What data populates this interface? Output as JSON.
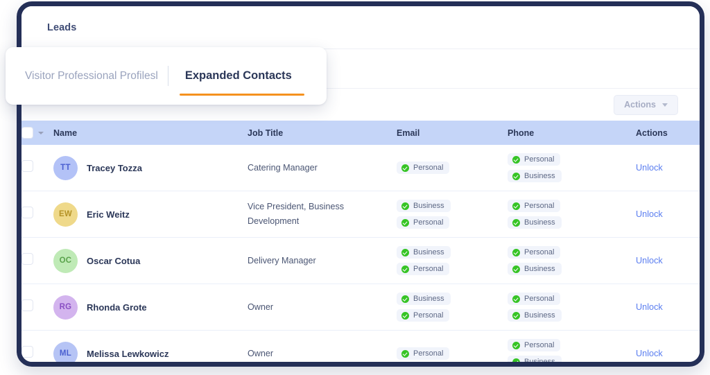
{
  "window": {
    "frame_color": "#242f57"
  },
  "header": {
    "title": "Leads"
  },
  "tabs": {
    "inactive_label": "Visitor Professional Profilesl",
    "active_label": "Expanded Contacts",
    "active_underline_color": "#f5911e"
  },
  "toolbar": {
    "actions_label": "Actions",
    "actions_caret": "chevron-down-icon"
  },
  "table": {
    "columns": [
      "Name",
      "Job Title",
      "Email",
      "Phone",
      "Actions"
    ],
    "header_bg": "#c5d5f8",
    "rows": [
      {
        "initials": "TT",
        "avatar_bg": "#b3c2f7",
        "avatar_fg": "#4a5fd0",
        "name": "Tracey Tozza",
        "job_title": "Catering Manager",
        "email_badges": [
          "Personal"
        ],
        "phone_badges": [
          "Personal",
          "Business"
        ],
        "action": "Unlock"
      },
      {
        "initials": "EW",
        "avatar_bg": "#efd98a",
        "avatar_fg": "#b59327",
        "name": "Eric Weitz",
        "job_title": "Vice President, Business Development",
        "email_badges": [
          "Business",
          "Personal"
        ],
        "phone_badges": [
          "Personal",
          "Business"
        ],
        "action": "Unlock"
      },
      {
        "initials": "OC",
        "avatar_bg": "#bfeab6",
        "avatar_fg": "#5aa34c",
        "name": "Oscar Cotua",
        "job_title": "Delivery Manager",
        "email_badges": [
          "Business",
          "Personal"
        ],
        "phone_badges": [
          "Personal",
          "Business"
        ],
        "action": "Unlock"
      },
      {
        "initials": "RG",
        "avatar_bg": "#d3b4ee",
        "avatar_fg": "#8a4fc4",
        "name": "Rhonda Grote",
        "job_title": "Owner",
        "email_badges": [
          "Business",
          "Personal"
        ],
        "phone_badges": [
          "Personal",
          "Business"
        ],
        "action": "Unlock"
      },
      {
        "initials": "ML",
        "avatar_bg": "#b6c4f5",
        "avatar_fg": "#4a5fd0",
        "name": "Melissa Lewkowicz",
        "job_title": "Owner",
        "email_badges": [
          "Personal"
        ],
        "phone_badges": [
          "Personal",
          "Business"
        ],
        "action": "Unlock"
      }
    ]
  }
}
